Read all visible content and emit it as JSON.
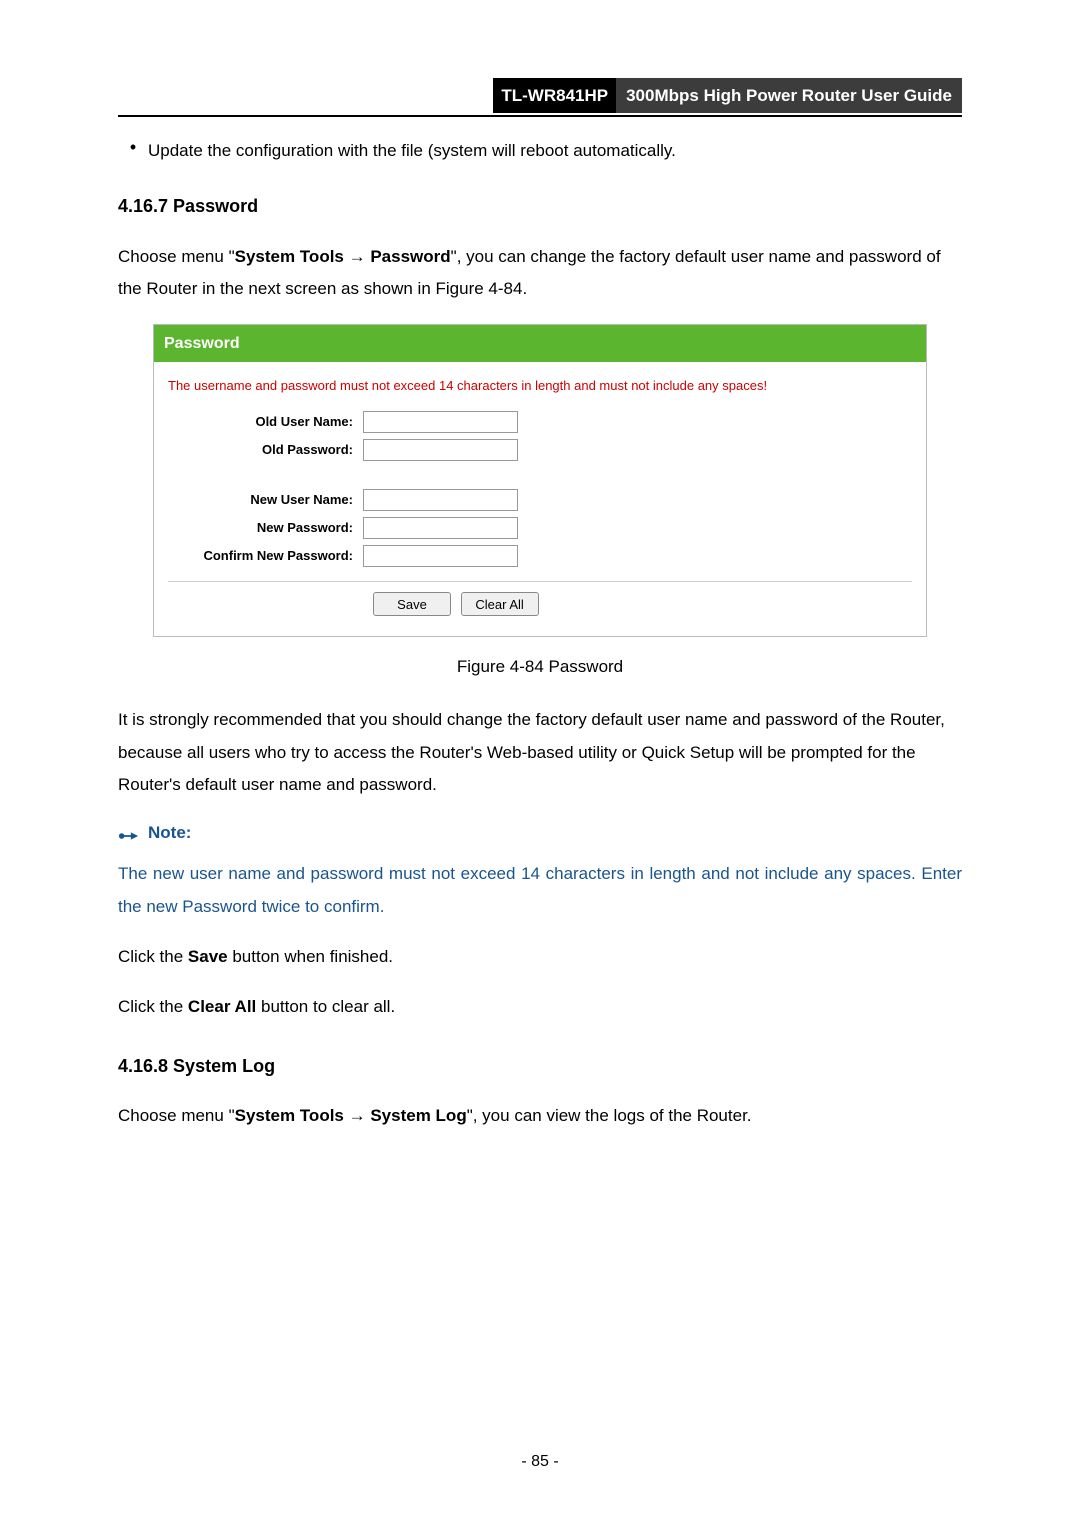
{
  "header": {
    "model": "TL-WR841HP",
    "title": "300Mbps High Power Router User Guide"
  },
  "bullet": {
    "text": "Update the configuration with the file (system will reboot automatically."
  },
  "section_password": {
    "heading": "4.16.7 Password",
    "intro_prefix": "Choose menu \"",
    "intro_bold1": "System Tools",
    "intro_arrow": " → ",
    "intro_bold2": "Password",
    "intro_suffix": "\", you can change the factory default user name and password of the Router in the next screen as shown in Figure 4-84."
  },
  "figure": {
    "panel_title": "Password",
    "warning": "The username and password must not exceed 14 characters in length and must not include any spaces!",
    "labels": {
      "old_user": "Old User Name:",
      "old_pass": "Old Password:",
      "new_user": "New User Name:",
      "new_pass": "New Password:",
      "confirm": "Confirm New Password:"
    },
    "buttons": {
      "save": "Save",
      "clear": "Clear All"
    },
    "caption": "Figure 4-84    Password"
  },
  "after_figure": {
    "para": "It is strongly recommended that you should change the factory default user name and password of the Router, because all users who try to access the Router's Web-based utility or Quick Setup will be prompted for the Router's default user name and password."
  },
  "note": {
    "label": "Note:",
    "body": "The new user name and password must not exceed 14 characters in length and not include any spaces. Enter the new Password twice to confirm."
  },
  "instructions": {
    "save_prefix": "Click the ",
    "save_bold": "Save",
    "save_suffix": " button when finished.",
    "clear_prefix": "Click the ",
    "clear_bold": "Clear All",
    "clear_suffix": " button to clear all."
  },
  "section_syslog": {
    "heading": "4.16.8 System Log",
    "intro_prefix": "Choose menu \"",
    "intro_bold1": "System Tools",
    "intro_arrow": " → ",
    "intro_bold2": "System Log",
    "intro_suffix": "\", you can view the logs of the Router."
  },
  "page_number": "- 85 -"
}
